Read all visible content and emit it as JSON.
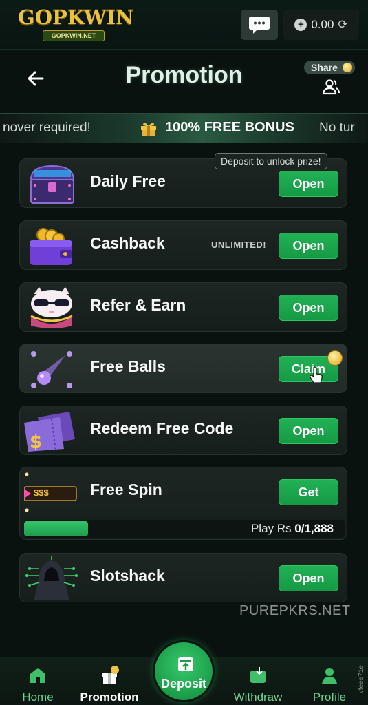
{
  "topbar": {
    "logo_text": "GOPKWIN",
    "logo_sub": "GOPKWIN.NET",
    "balance": "0.00"
  },
  "header": {
    "title": "Promotion",
    "share_label": "Share"
  },
  "marquee": {
    "left_text": "nover required!",
    "bonus_text": "100% FREE BONUS",
    "right_text": "No tur"
  },
  "tooltip": "Deposit to unlock prize!",
  "promos": [
    {
      "label": "Daily Free",
      "button": "Open"
    },
    {
      "label": "Cashback",
      "badge": "UNLIMITED!",
      "button": "Open"
    },
    {
      "label": "Refer & Earn",
      "button": "Open"
    },
    {
      "label": "Free Balls",
      "button": "Claim"
    },
    {
      "label": "Redeem Free Code",
      "button": "Open"
    },
    {
      "label": "Free Spin",
      "button": "Get",
      "icon_text": "$$$",
      "progress_label": "Play Rs",
      "progress_value": "0/1,888",
      "progress_fraction": 0.2
    },
    {
      "label": "Slotshack",
      "button": "Open"
    }
  ],
  "watermark": "PUREPKRS.NET",
  "nav": {
    "home": "Home",
    "promotion": "Promotion",
    "deposit": "Deposit",
    "withdraw": "Withdraw",
    "profile": "Profile"
  },
  "side_text": "vfeee71e",
  "colors": {
    "accent_green": "#1fa84f",
    "background": "#0a1210",
    "gold": "#e9c23c"
  }
}
